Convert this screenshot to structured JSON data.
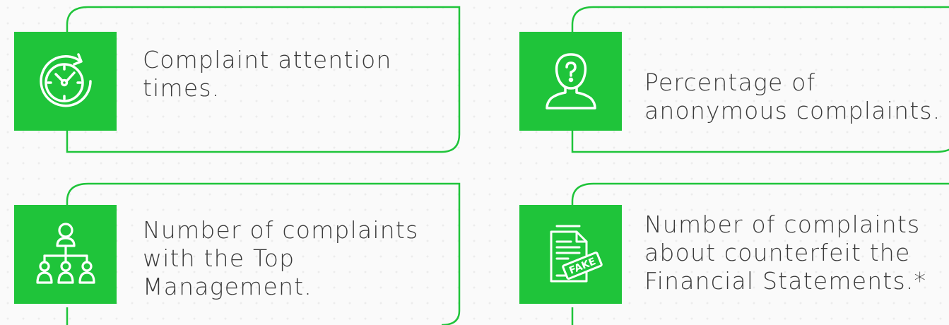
{
  "cards": [
    {
      "icon": "clock-icon",
      "lines": [
        "Complaint attention",
        "times."
      ]
    },
    {
      "icon": "anonymous-person-icon",
      "lines": [
        "Percentage of",
        "anonymous complaints."
      ]
    },
    {
      "icon": "org-chart-icon",
      "lines": [
        "Number of complaints",
        "with the Top",
        "Management."
      ]
    },
    {
      "icon": "fake-document-icon",
      "lines": [
        "Number of complaints",
        "about counterfeit the",
        "Financial Statements.*"
      ]
    }
  ],
  "colors": {
    "accent": "#1fc43a",
    "text": "#3a3a3a",
    "background": "#fafafa"
  }
}
